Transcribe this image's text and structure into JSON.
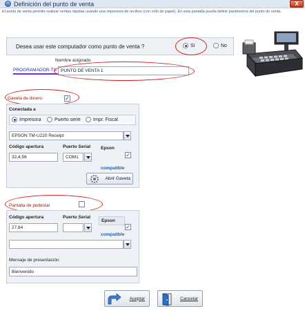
{
  "window": {
    "title": "Definición del punto de venta",
    "close_label": "X"
  },
  "description": "El punto de venta permite realizar ventas rápidas usando una impresora de recibos (con rollo de papel). En esta pantalla puede definir parámetros del punto de venta.",
  "question": {
    "text": "Desea usar este computador como punto de venta ?",
    "options": [
      {
        "label": "Sí",
        "selected": true
      },
      {
        "label": "No",
        "selected": false
      }
    ]
  },
  "name": {
    "label": "Nombre asignado",
    "machine_label": "PROGRAMADOR-TS",
    "value": "PUNTO DE VENTA 1"
  },
  "gaveta": {
    "label": "Gaveta de dinero",
    "checked": true,
    "connected_label": "Conectada a",
    "options": [
      {
        "label": "Impresora",
        "selected": true
      },
      {
        "label": "Puerto serie",
        "selected": false
      },
      {
        "label": "Impr. Fiscal",
        "selected": false
      }
    ],
    "printer": "EPSON TM-U220 Receipt",
    "code_label": "Código apertura",
    "code_value": "32,4,56",
    "port_label": "Puerto Serial",
    "port_value": "COM1",
    "epson_label": "Epson",
    "compatible_label": "compatible",
    "epson_checked": true,
    "open_button": "Abrir Gaveta"
  },
  "pedestal": {
    "label": "Pantalla de pedestal",
    "checked": false,
    "code_label": "Código apertura",
    "code_value": "27,64",
    "port_label": "Puerto Serial",
    "port_value": "",
    "epson_label": "Epson",
    "compatible_label": "compatible",
    "epson_checked": true,
    "select_value": "",
    "message_label": "Mensaje de presentación",
    "message_value": "Bienvenido"
  },
  "footer": {
    "accept_label": "Aceptar",
    "cancel_label": "Cancelar"
  },
  "colors": {
    "accent": "#2b5a9a",
    "highlight": "#d32020",
    "section_label": "#a01414"
  }
}
